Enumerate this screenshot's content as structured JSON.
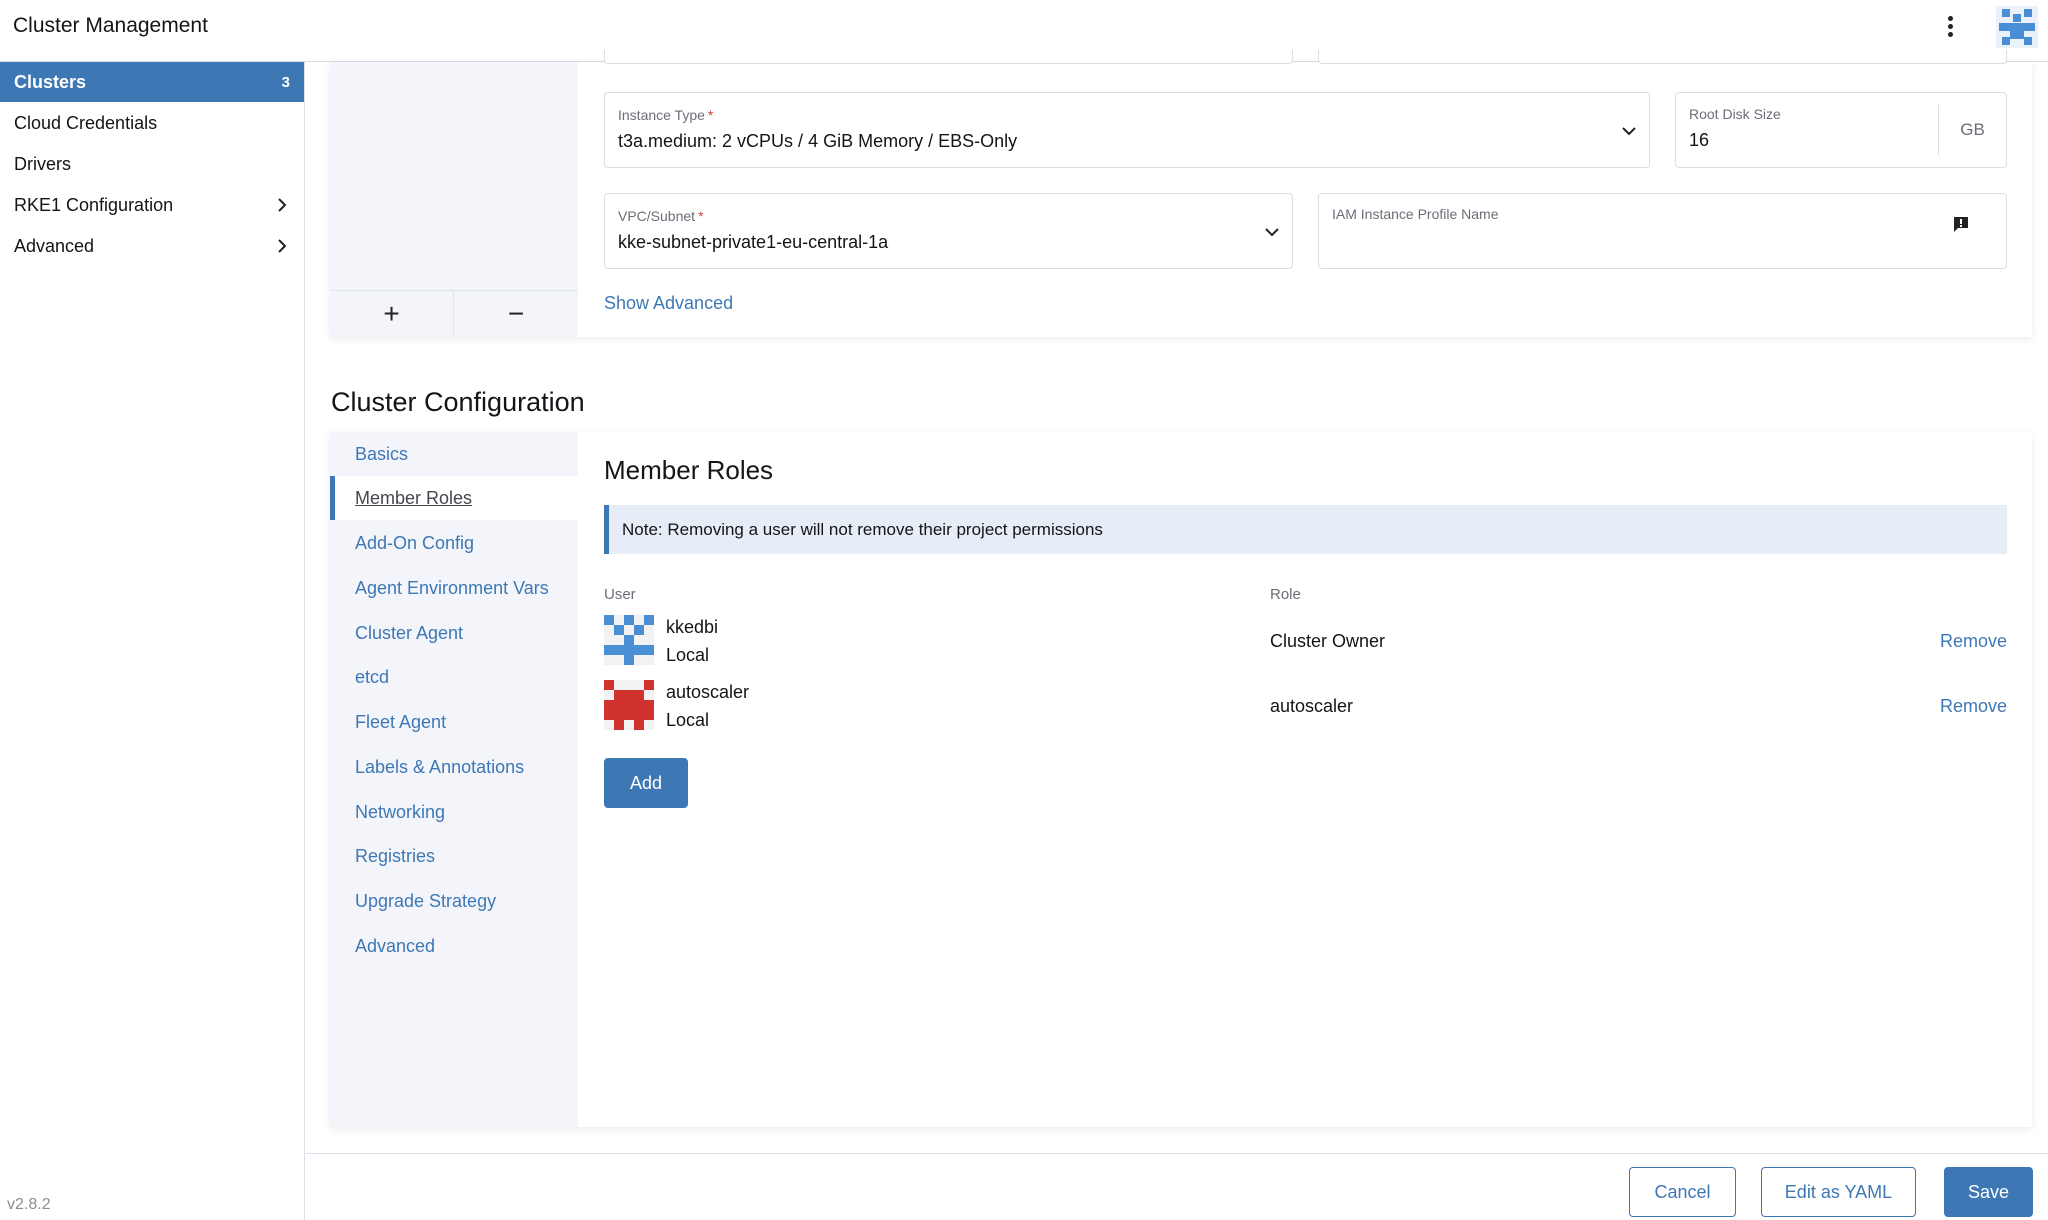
{
  "header": {
    "title": "Cluster Management"
  },
  "sidebar": {
    "items": [
      {
        "label": "Clusters",
        "count": "3"
      },
      {
        "label": "Cloud Credentials"
      },
      {
        "label": "Drivers"
      },
      {
        "label": "RKE1 Configuration"
      },
      {
        "label": "Advanced"
      }
    ],
    "version": "v2.8.2"
  },
  "node_pool": {
    "instance_type": {
      "label": "Instance Type",
      "required": "*",
      "value": "t3a.medium: 2 vCPUs / 4 GiB Memory / EBS-Only"
    },
    "root_disk": {
      "label": "Root Disk Size",
      "value": "16",
      "unit": "GB"
    },
    "vpc_subnet": {
      "label": "VPC/Subnet",
      "required": "*",
      "value": "kke-subnet-private1-eu-central-1a"
    },
    "iam_profile": {
      "label": "IAM Instance Profile Name",
      "value": ""
    },
    "show_advanced": "Show Advanced",
    "add_pool": "+",
    "remove_pool": "−"
  },
  "cluster_config": {
    "title": "Cluster Configuration",
    "tabs": [
      "Basics",
      "Member Roles",
      "Add-On Config",
      "Agent Environment Vars",
      "Cluster Agent",
      "etcd",
      "Fleet Agent",
      "Labels & Annotations",
      "Networking",
      "Registries",
      "Upgrade Strategy",
      "Advanced"
    ],
    "active_tab": "Member Roles"
  },
  "member_roles": {
    "title": "Member Roles",
    "note": "Note: Removing a user will not remove their project permissions",
    "columns": {
      "user": "User",
      "role": "Role"
    },
    "members": [
      {
        "name": "kkedbi",
        "provider": "Local",
        "role": "Cluster Owner",
        "action": "Remove"
      },
      {
        "name": "autoscaler",
        "provider": "Local",
        "role": "autoscaler",
        "action": "Remove"
      }
    ],
    "add_label": "Add"
  },
  "footer": {
    "cancel": "Cancel",
    "edit_yaml": "Edit as YAML",
    "save": "Save"
  },
  "colors": {
    "accent": "#3d78b5",
    "avatar_blue": "#4a8fd6",
    "avatar_red": "#d0322e",
    "required": "#d13b3b"
  },
  "icons": {
    "menu": "kebab-menu-icon",
    "chevron": "chevron-right-icon",
    "dropdown": "chevron-down-icon",
    "info": "info-flag-icon"
  }
}
